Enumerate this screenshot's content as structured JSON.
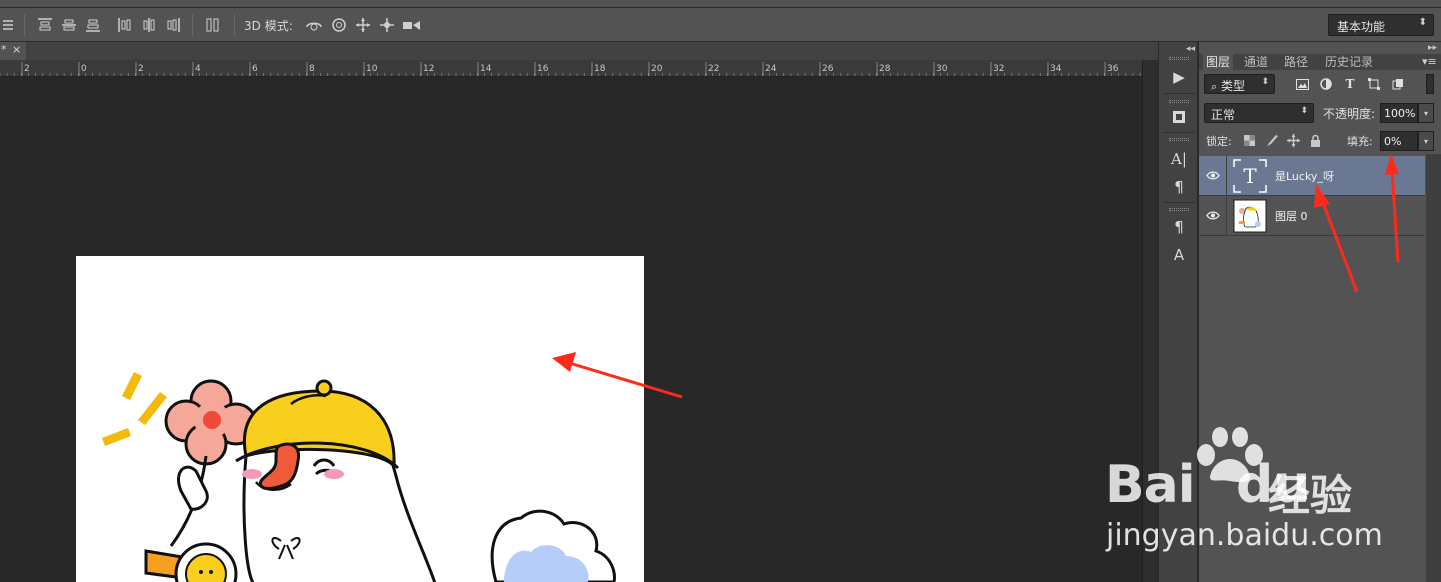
{
  "options_bar": {
    "mode_3d_label": "3D 模式:",
    "workspace": "基本功能",
    "icons": [
      "align-top-icon",
      "align-vcenter-icon",
      "align-bottom-icon",
      "align-left-icon",
      "align-hcenter-icon",
      "align-right-icon",
      "distribute-icon",
      "orbit-3d-icon",
      "roll-3d-icon",
      "pan-3d-icon",
      "slide-3d-icon",
      "scale-3d-icon"
    ]
  },
  "document": {
    "tab_mark": "*",
    "tab_close": "×",
    "ruler_labels": [
      "2",
      "0",
      "2",
      "4",
      "6",
      "8",
      "10",
      "12",
      "14",
      "16",
      "18",
      "20",
      "22",
      "24",
      "26",
      "28",
      "30",
      "32",
      "34",
      "36"
    ]
  },
  "panel": {
    "tabs": [
      "图层",
      "通道",
      "路径",
      "历史记录"
    ],
    "active_tab": "图层",
    "filter_kind": "类型",
    "blend_mode": "正常",
    "opacity_label": "不透明度:",
    "opacity_value": "100%",
    "lock_label": "锁定:",
    "fill_label": "填充:",
    "fill_value": "0%",
    "layers": [
      {
        "name": "是Lucky_呀",
        "type": "text",
        "selected": true
      },
      {
        "name": "图层 0",
        "type": "image",
        "selected": false
      }
    ]
  },
  "watermark": {
    "brand_left": "Bai",
    "brand_right": "du",
    "brand_cn": "经验",
    "url": "jingyan.baidu.com"
  },
  "colors": {
    "annotation_arrow": "#ff2a1a",
    "selected_layer": "#6b7894",
    "panel_bg": "#535353"
  }
}
